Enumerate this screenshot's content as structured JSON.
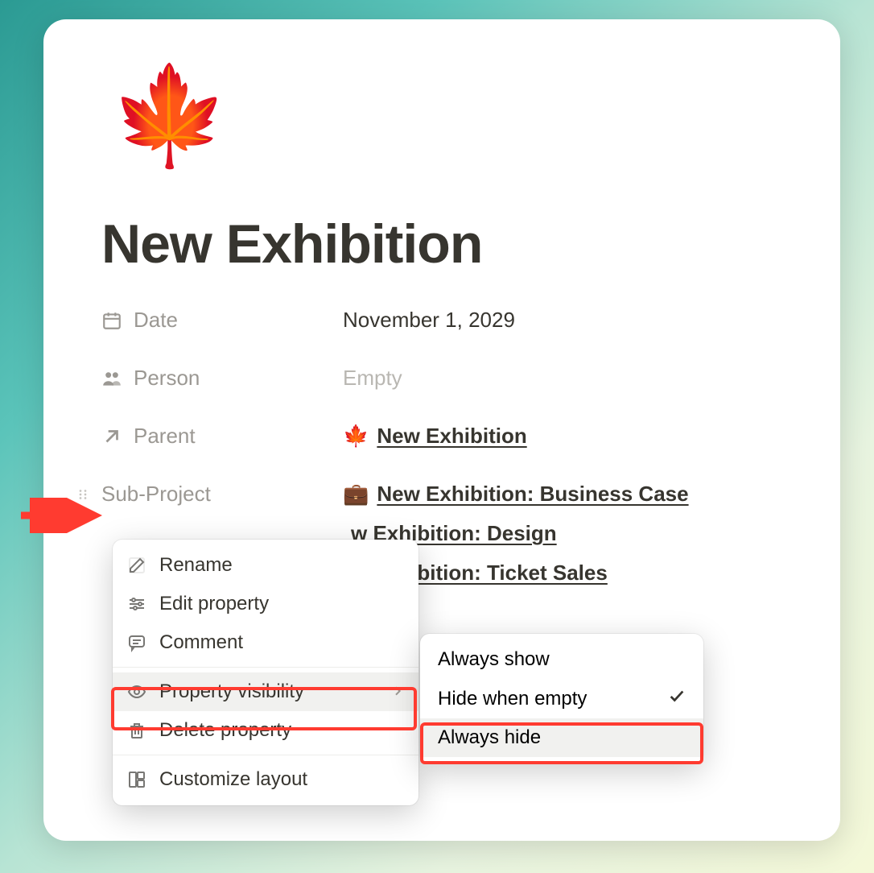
{
  "page": {
    "icon": "🍁",
    "title": "New Exhibition"
  },
  "properties": {
    "date": {
      "label": "Date",
      "value": "November 1, 2029"
    },
    "person": {
      "label": "Person",
      "value": "Empty"
    },
    "parent": {
      "label": "Parent",
      "items": [
        {
          "icon": "🍁",
          "text": "New Exhibition"
        }
      ]
    },
    "subproject": {
      "label": "Sub-Project",
      "items": [
        {
          "icon": "💼",
          "text": "New Exhibition: Business Case"
        },
        {
          "icon": "",
          "text": "w Exhibition: Design"
        },
        {
          "icon": "",
          "text": "w Exhibition: Ticket Sales"
        }
      ]
    }
  },
  "menu": {
    "rename": "Rename",
    "edit_property": "Edit property",
    "comment": "Comment",
    "property_visibility": "Property visibility",
    "delete_property": "Delete property",
    "customize_layout": "Customize layout"
  },
  "submenu": {
    "always_show": "Always show",
    "hide_when_empty": "Hide when empty",
    "always_hide": "Always hide"
  }
}
